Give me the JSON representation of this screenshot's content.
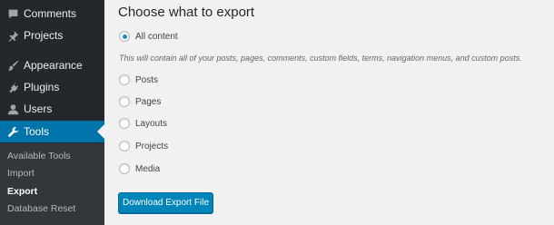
{
  "sidebar": {
    "items": [
      {
        "label": "Comments",
        "icon": "comments-icon"
      },
      {
        "label": "Projects",
        "icon": "pin-icon"
      },
      {
        "label": "Appearance",
        "icon": "paintbrush-icon"
      },
      {
        "label": "Plugins",
        "icon": "plugin-icon"
      },
      {
        "label": "Users",
        "icon": "users-icon"
      },
      {
        "label": "Tools",
        "icon": "wrench-icon",
        "active": true
      }
    ],
    "submenu": [
      {
        "label": "Available Tools"
      },
      {
        "label": "Import"
      },
      {
        "label": "Export",
        "current": true
      },
      {
        "label": "Database Reset"
      }
    ]
  },
  "main": {
    "heading": "Choose what to export",
    "options": [
      {
        "label": "All content",
        "checked": true
      },
      {
        "label": "Posts"
      },
      {
        "label": "Pages"
      },
      {
        "label": "Layouts"
      },
      {
        "label": "Projects"
      },
      {
        "label": "Media"
      }
    ],
    "description": "This will contain all of your posts, pages, comments, custom fields, terms, navigation menus, and custom posts.",
    "download_button": "Download Export File"
  },
  "colors": {
    "sidebar_bg": "#23282d",
    "submenu_bg": "#32373c",
    "active_bg": "#0073aa",
    "button_bg": "#0085ba",
    "radio_dot": "#1e8cbe"
  }
}
